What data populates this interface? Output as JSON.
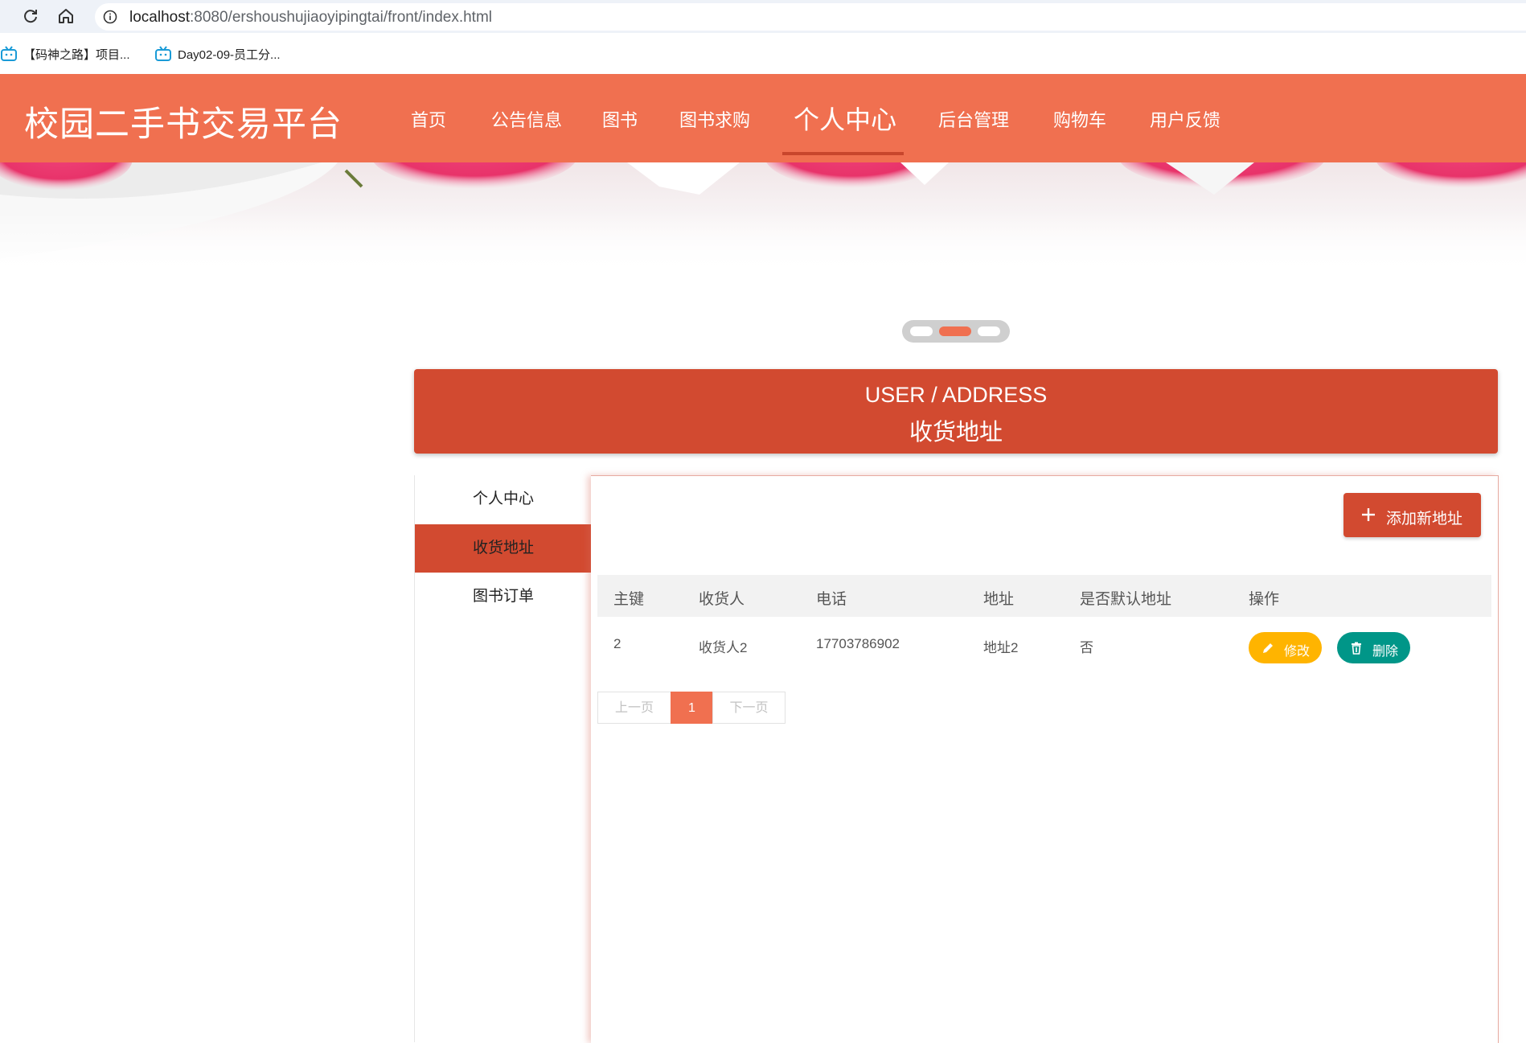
{
  "browser": {
    "url_host": "localhost",
    "url_path": ":8080/ershoushujiaoyipingtai/front/index.html"
  },
  "bookmarks": [
    {
      "label": "【码神之路】项目..."
    },
    {
      "label": "Day02-09-员工分..."
    }
  ],
  "header": {
    "site_title": "校园二手书交易平台",
    "nav": [
      {
        "label": "首页"
      },
      {
        "label": "公告信息"
      },
      {
        "label": "图书"
      },
      {
        "label": "图书求购"
      },
      {
        "label": "个人中心"
      },
      {
        "label": "后台管理"
      },
      {
        "label": "购物车"
      },
      {
        "label": "用户反馈"
      }
    ],
    "active_nav": "个人中心"
  },
  "carousel": {
    "slide_count": 3,
    "active_index": 1
  },
  "title_panel": {
    "en": "USER / ADDRESS",
    "cn": "收货地址"
  },
  "sidebar": {
    "items": [
      {
        "label": "个人中心"
      },
      {
        "label": "收货地址"
      },
      {
        "label": "图书订单"
      }
    ],
    "active": "收货地址"
  },
  "toolbar": {
    "add_label": "添加新地址"
  },
  "table": {
    "headers": [
      "主键",
      "收货人",
      "电话",
      "地址",
      "是否默认地址",
      "操作"
    ],
    "rows": [
      {
        "id": "2",
        "consignee": "收货人2",
        "phone": "17703786902",
        "address": "地址2",
        "is_default": "否"
      }
    ],
    "edit_label": "修改",
    "delete_label": "删除"
  },
  "pagination": {
    "prev_label": "上一页",
    "current_page": "1",
    "next_label": "下一页"
  },
  "colors": {
    "header_bg": "#f07050",
    "panel_bg": "#d24a30",
    "edit_btn": "#ffb400",
    "delete_btn": "#009688"
  }
}
